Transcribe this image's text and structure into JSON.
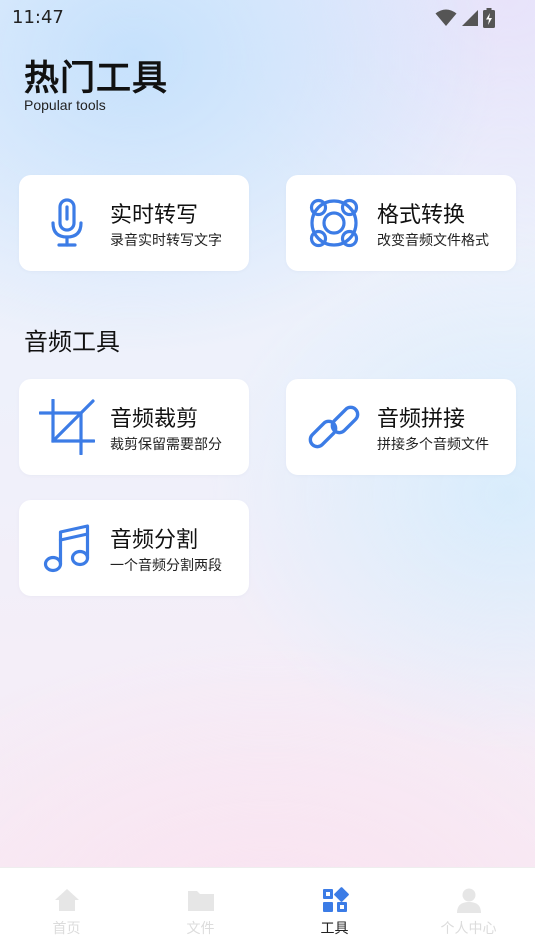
{
  "status_bar": {
    "time": "11:47",
    "icons": [
      "wifi-icon",
      "cellular-signal-icon",
      "battery-charging-icon"
    ]
  },
  "header": {
    "title": "热门工具",
    "subtitle": "Popular tools"
  },
  "popular_tools": [
    {
      "title": "实时转写",
      "description": "录音实时转写文字",
      "icon": "microphone-icon"
    },
    {
      "title": "格式转换",
      "description": "改变音频文件格式",
      "icon": "lifebuoy-icon"
    }
  ],
  "audio_section": {
    "title": "音频工具",
    "tools": [
      {
        "title": "音频裁剪",
        "description": "裁剪保留需要部分",
        "icon": "crop-icon"
      },
      {
        "title": "音频拼接",
        "description": "拼接多个音频文件",
        "icon": "link-icon"
      },
      {
        "title": "音频分割",
        "description": "一个音频分割两段",
        "icon": "music-note-icon"
      }
    ]
  },
  "bottom_nav": {
    "items": [
      {
        "label": "首页",
        "icon": "home-icon",
        "active": false
      },
      {
        "label": "文件",
        "icon": "folder-icon",
        "active": false
      },
      {
        "label": "工具",
        "icon": "tools-grid-icon",
        "active": true
      },
      {
        "label": "个人中心",
        "icon": "person-icon",
        "active": false
      }
    ]
  },
  "colors": {
    "accent": "#3c7ce6",
    "inactive_nav": "#dcdcdc",
    "card_bg": "#ffffff"
  }
}
